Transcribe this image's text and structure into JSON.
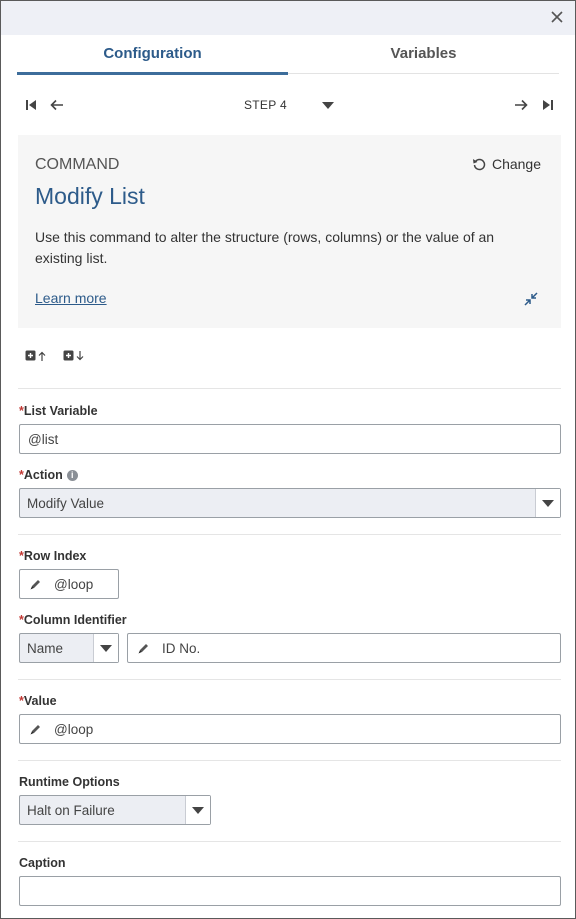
{
  "header": {
    "close_icon": "close-icon"
  },
  "tabs": [
    {
      "label": "Configuration",
      "active": true
    },
    {
      "label": "Variables",
      "active": false
    }
  ],
  "stepnav": {
    "step_label": "STEP 4"
  },
  "command": {
    "eyebrow": "COMMAND",
    "change_label": "Change",
    "title": "Modify List",
    "description": "Use this command to alter the structure (rows, columns) or the value of an existing list.",
    "learn_more": "Learn more"
  },
  "form": {
    "list_variable": {
      "label": "List Variable",
      "value": "@list"
    },
    "action": {
      "label": "Action",
      "value": "Modify Value"
    },
    "row_index": {
      "label": "Row Index",
      "value": "@loop"
    },
    "column_identifier": {
      "label": "Column Identifier",
      "type_value": "Name",
      "value": "ID No."
    },
    "value": {
      "label": "Value",
      "value": "@loop"
    },
    "runtime_options": {
      "label": "Runtime Options",
      "value": "Halt on Failure"
    },
    "caption": {
      "label": "Caption",
      "value": ""
    }
  },
  "colors": {
    "accent": "#2d5b8a",
    "tab_underline": "#3d6d9b",
    "required": "#c23934",
    "command_bg": "#f6f6f6",
    "topbar_bg": "#eef0f6"
  }
}
